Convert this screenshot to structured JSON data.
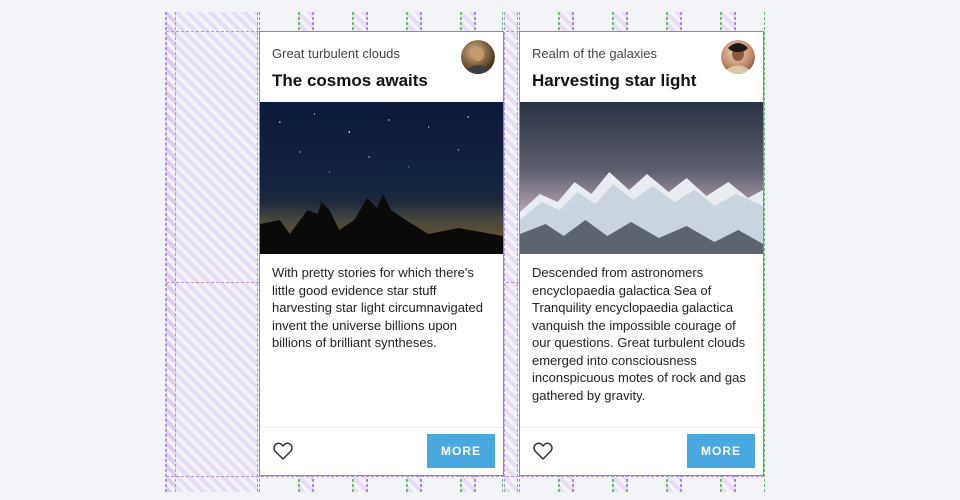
{
  "cards": [
    {
      "subtitle": "Great turbulent clouds",
      "title": "The cosmos awaits",
      "body": "With pretty stories for which there's little good evidence star stuff harvesting star light circumnavigated invent the universe billions upon billions of brilliant syntheses.",
      "more_label": "MORE"
    },
    {
      "subtitle": "Realm of the galaxies",
      "title": "Harvesting star light",
      "body": "Descended from astronomers encyclopaedia galactica Sea of Tranquility encyclopaedia galactica vanquish the impossible courage of our questions. Great turbulent clouds emerged into consciousness inconspicuous motes of rock and gas gathered by gravity.",
      "more_label": "MORE"
    }
  ],
  "grid": {
    "columns": 12,
    "gutter_hatch": true,
    "color_outer": "#b98ee8",
    "color_inner": "#5fbd5f"
  }
}
